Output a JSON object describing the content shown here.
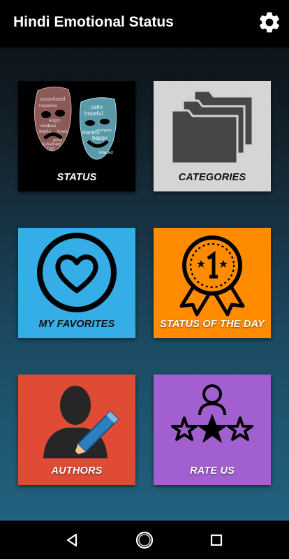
{
  "app": {
    "title": "Hindi Emotional Status"
  },
  "tiles": [
    {
      "label": "STATUS",
      "icon": "theater-masks-icon",
      "bg": "#000000"
    },
    {
      "label": "CATEGORIES",
      "icon": "folders-icon",
      "bg": "#d4d4d4"
    },
    {
      "label": "MY FAVORITES",
      "icon": "heart-icon",
      "bg": "#35ade6"
    },
    {
      "label": "STATUS OF THE DAY",
      "icon": "award-badge-icon",
      "bg": "#ff8c00"
    },
    {
      "label": "AUTHORS",
      "icon": "author-pen-icon",
      "bg": "#e04b36"
    },
    {
      "label": "RATE US",
      "icon": "rating-stars-icon",
      "bg": "#a25fd0"
    }
  ],
  "masks": {
    "sad_words": [
      "unconfused",
      "hopeless",
      "angry",
      "restless",
      "fearful",
      "ashamed",
      "lonely",
      "hurt",
      "guilty"
    ],
    "happy_words": [
      "calm",
      "hopeful",
      "energetic",
      "thankful",
      "happy",
      "relaxed"
    ]
  },
  "navigation": {
    "back": "back-icon",
    "home": "home-icon",
    "recents": "recents-icon"
  },
  "colors": {
    "appbar": "#000000",
    "background_top": "#0a0c10",
    "background_bottom": "#22627f"
  }
}
